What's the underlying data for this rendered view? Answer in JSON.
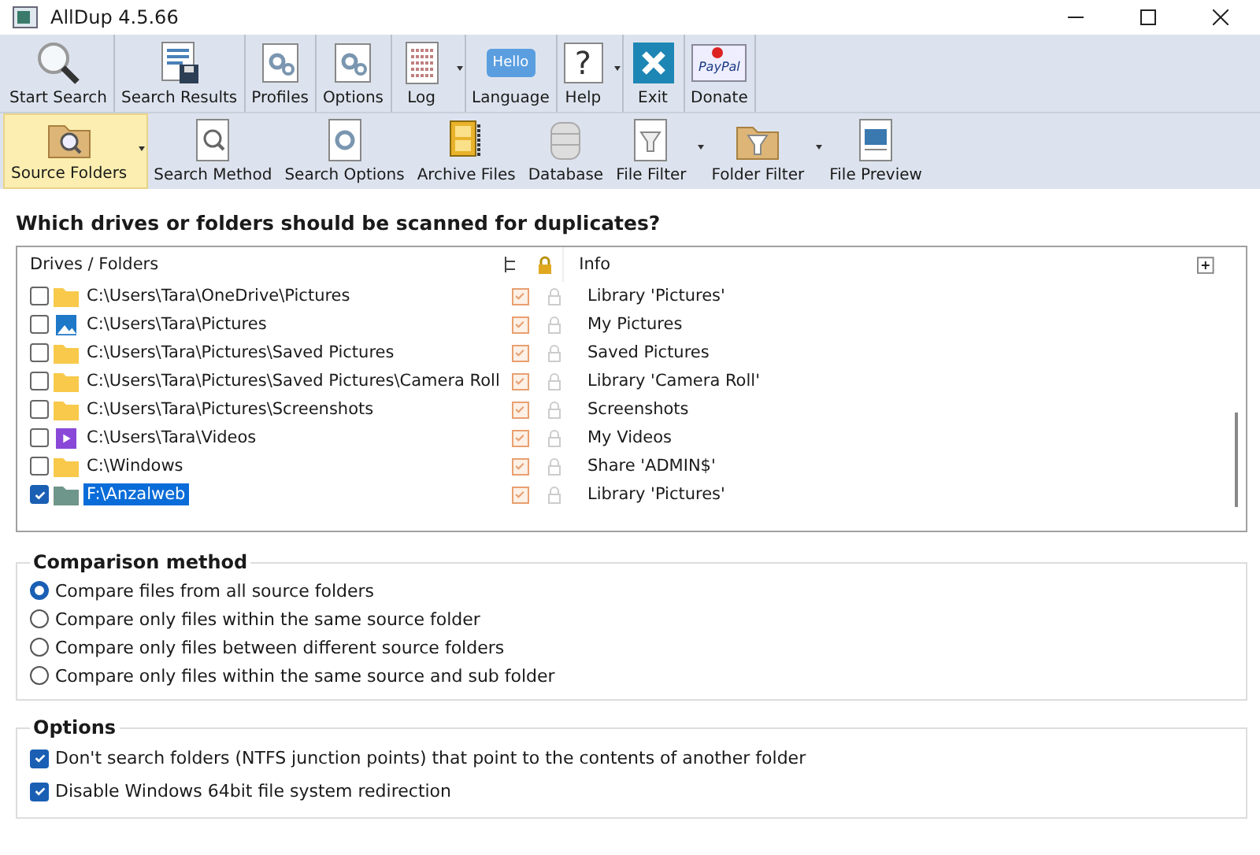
{
  "window": {
    "title": "AllDup 4.5.66"
  },
  "toolbar": [
    {
      "label": "Start Search",
      "has_menu": false
    },
    {
      "label": "Search Results",
      "has_menu": false
    },
    {
      "label": "Profiles",
      "has_menu": false
    },
    {
      "label": "Options",
      "has_menu": false
    },
    {
      "label": "Log",
      "has_menu": true
    },
    {
      "label": "Language",
      "has_menu": false,
      "icon_text": "Hello"
    },
    {
      "label": "Help",
      "has_menu": true,
      "icon_text": "?"
    },
    {
      "label": "Exit",
      "has_menu": false
    },
    {
      "label": "Donate",
      "has_menu": false,
      "icon_text": "PayPal"
    }
  ],
  "tabs": [
    {
      "label": "Source Folders",
      "selected": true,
      "has_menu": true
    },
    {
      "label": "Search Method",
      "selected": false,
      "has_menu": false
    },
    {
      "label": "Search Options",
      "selected": false,
      "has_menu": false
    },
    {
      "label": "Archive Files",
      "selected": false,
      "has_menu": false
    },
    {
      "label": "Database",
      "selected": false,
      "has_menu": false
    },
    {
      "label": "File Filter",
      "selected": false,
      "has_menu": true
    },
    {
      "label": "Folder Filter",
      "selected": false,
      "has_menu": true
    },
    {
      "label": "File Preview",
      "selected": false,
      "has_menu": false
    }
  ],
  "heading": "Which drives or folders should be scanned for duplicates?",
  "folders": {
    "columns": [
      "Drives / Folders",
      "Info"
    ],
    "rows": [
      {
        "kind": "folder",
        "path": "C:\\Users\\Tara\\OneDrive\\Pictures",
        "info": "Library 'Pictures'",
        "checked": false,
        "selected": false,
        "subfolders": true,
        "locked": false
      },
      {
        "kind": "pictures",
        "path": "C:\\Users\\Tara\\Pictures",
        "info": "My Pictures",
        "checked": false,
        "selected": false,
        "subfolders": true,
        "locked": false
      },
      {
        "kind": "folder",
        "path": "C:\\Users\\Tara\\Pictures\\Saved Pictures",
        "info": "Saved Pictures",
        "checked": false,
        "selected": false,
        "subfolders": true,
        "locked": false
      },
      {
        "kind": "folder",
        "path": "C:\\Users\\Tara\\Pictures\\Saved Pictures\\Camera Roll",
        "info": "Library 'Camera Roll'",
        "checked": false,
        "selected": false,
        "subfolders": true,
        "locked": false
      },
      {
        "kind": "folder",
        "path": "C:\\Users\\Tara\\Pictures\\Screenshots",
        "info": "Screenshots",
        "checked": false,
        "selected": false,
        "subfolders": true,
        "locked": false
      },
      {
        "kind": "videos",
        "path": "C:\\Users\\Tara\\Videos",
        "info": "My Videos",
        "checked": false,
        "selected": false,
        "subfolders": true,
        "locked": false
      },
      {
        "kind": "folder",
        "path": "C:\\Windows",
        "info": "Share 'ADMIN$'",
        "checked": false,
        "selected": false,
        "subfolders": true,
        "locked": false
      },
      {
        "kind": "drive-folder",
        "path": "F:\\Anzalweb",
        "info": "Library 'Pictures'",
        "checked": true,
        "selected": true,
        "subfolders": true,
        "locked": false
      }
    ]
  },
  "comparison": {
    "title": "Comparison method",
    "options": [
      {
        "label": "Compare files from all source folders",
        "selected": true
      },
      {
        "label": "Compare only files within the same source folder",
        "selected": false
      },
      {
        "label": "Compare only files between different source folders",
        "selected": false
      },
      {
        "label": "Compare only files within the same source and sub folder",
        "selected": false
      }
    ]
  },
  "options": {
    "title": "Options",
    "items": [
      {
        "label": "Don't search folders (NTFS junction points) that point to the contents of another folder",
        "checked": true
      },
      {
        "label": "Disable Windows 64bit file system redirection",
        "checked": true
      }
    ]
  }
}
